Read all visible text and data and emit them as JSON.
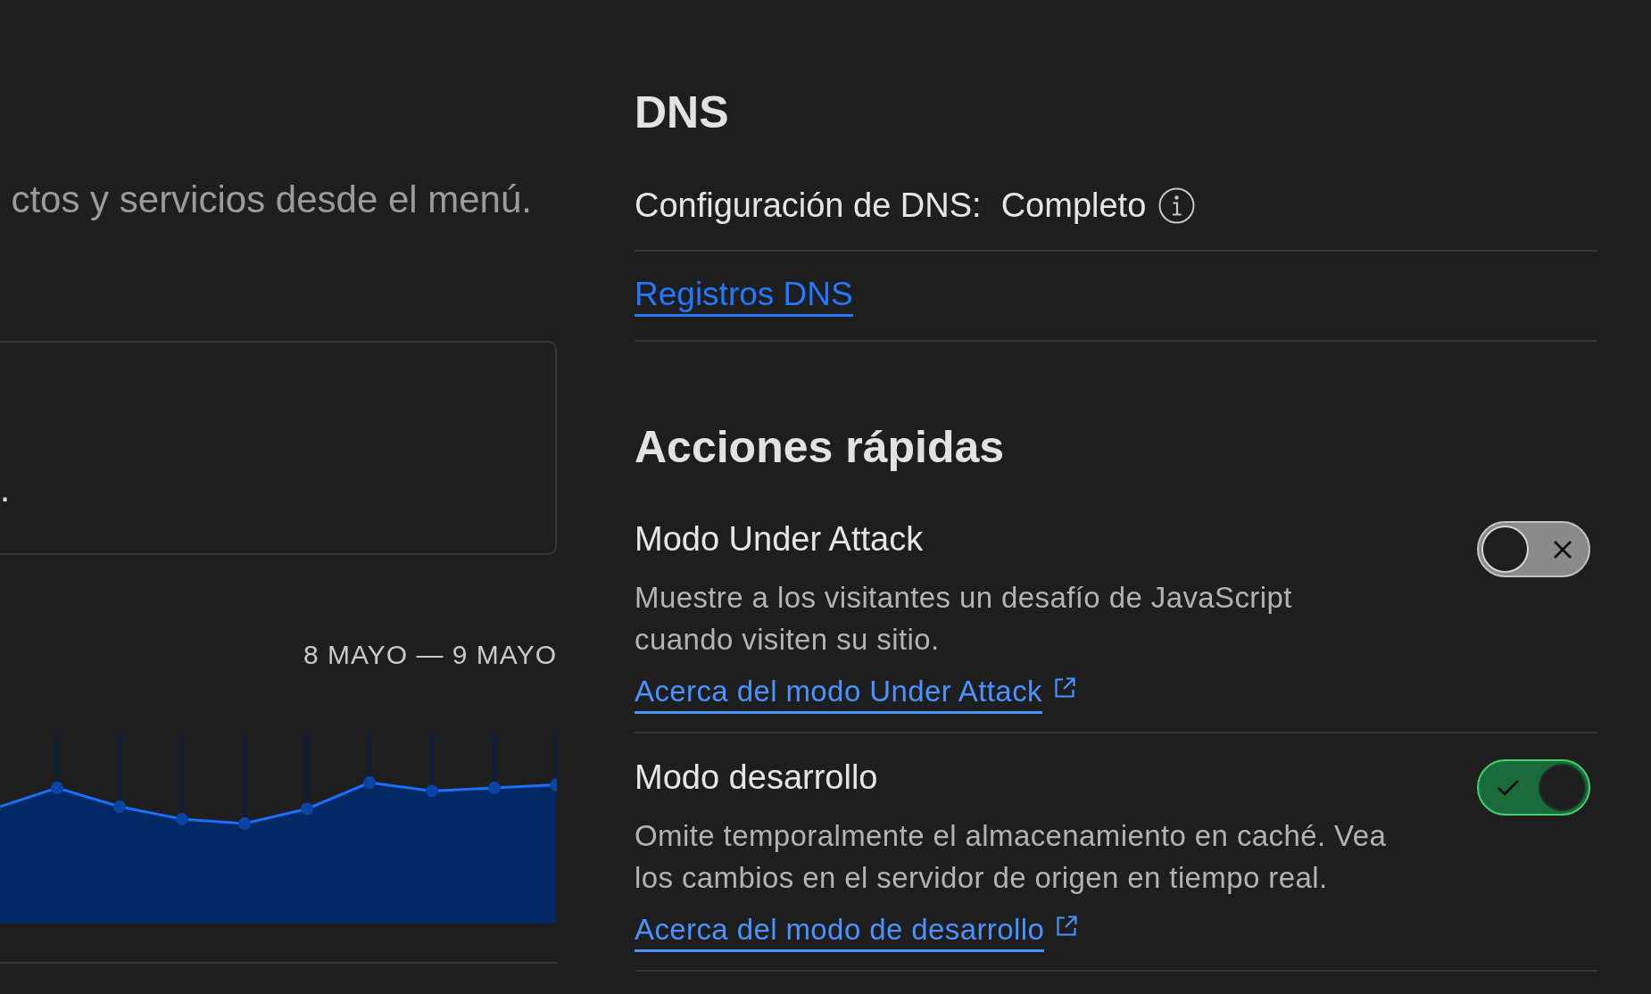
{
  "intro": {
    "text": "ctos y servicios desde el menú."
  },
  "card": {
    "text": "."
  },
  "traffic": {
    "date_range": "8 MAYO — 9 MAYO"
  },
  "dns": {
    "title": "DNS",
    "setup_label": "Configuración de DNS:",
    "setup_value": "Completo",
    "records_link": "Registros DNS"
  },
  "quick_actions": {
    "title": "Acciones rápidas",
    "items": [
      {
        "title": "Modo Under Attack",
        "description": "Muestre a los visitantes un desafío de JavaScript\ncuando visiten su sitio.",
        "link": "Acerca del modo Under Attack",
        "on": false
      },
      {
        "title": "Modo desarrollo",
        "description": "Omite temporalmente el almacenamiento en caché. Vea\nlos cambios en el servidor de origen en tiempo real.",
        "link": "Acerca del modo de desarrollo",
        "on": true
      }
    ]
  }
}
